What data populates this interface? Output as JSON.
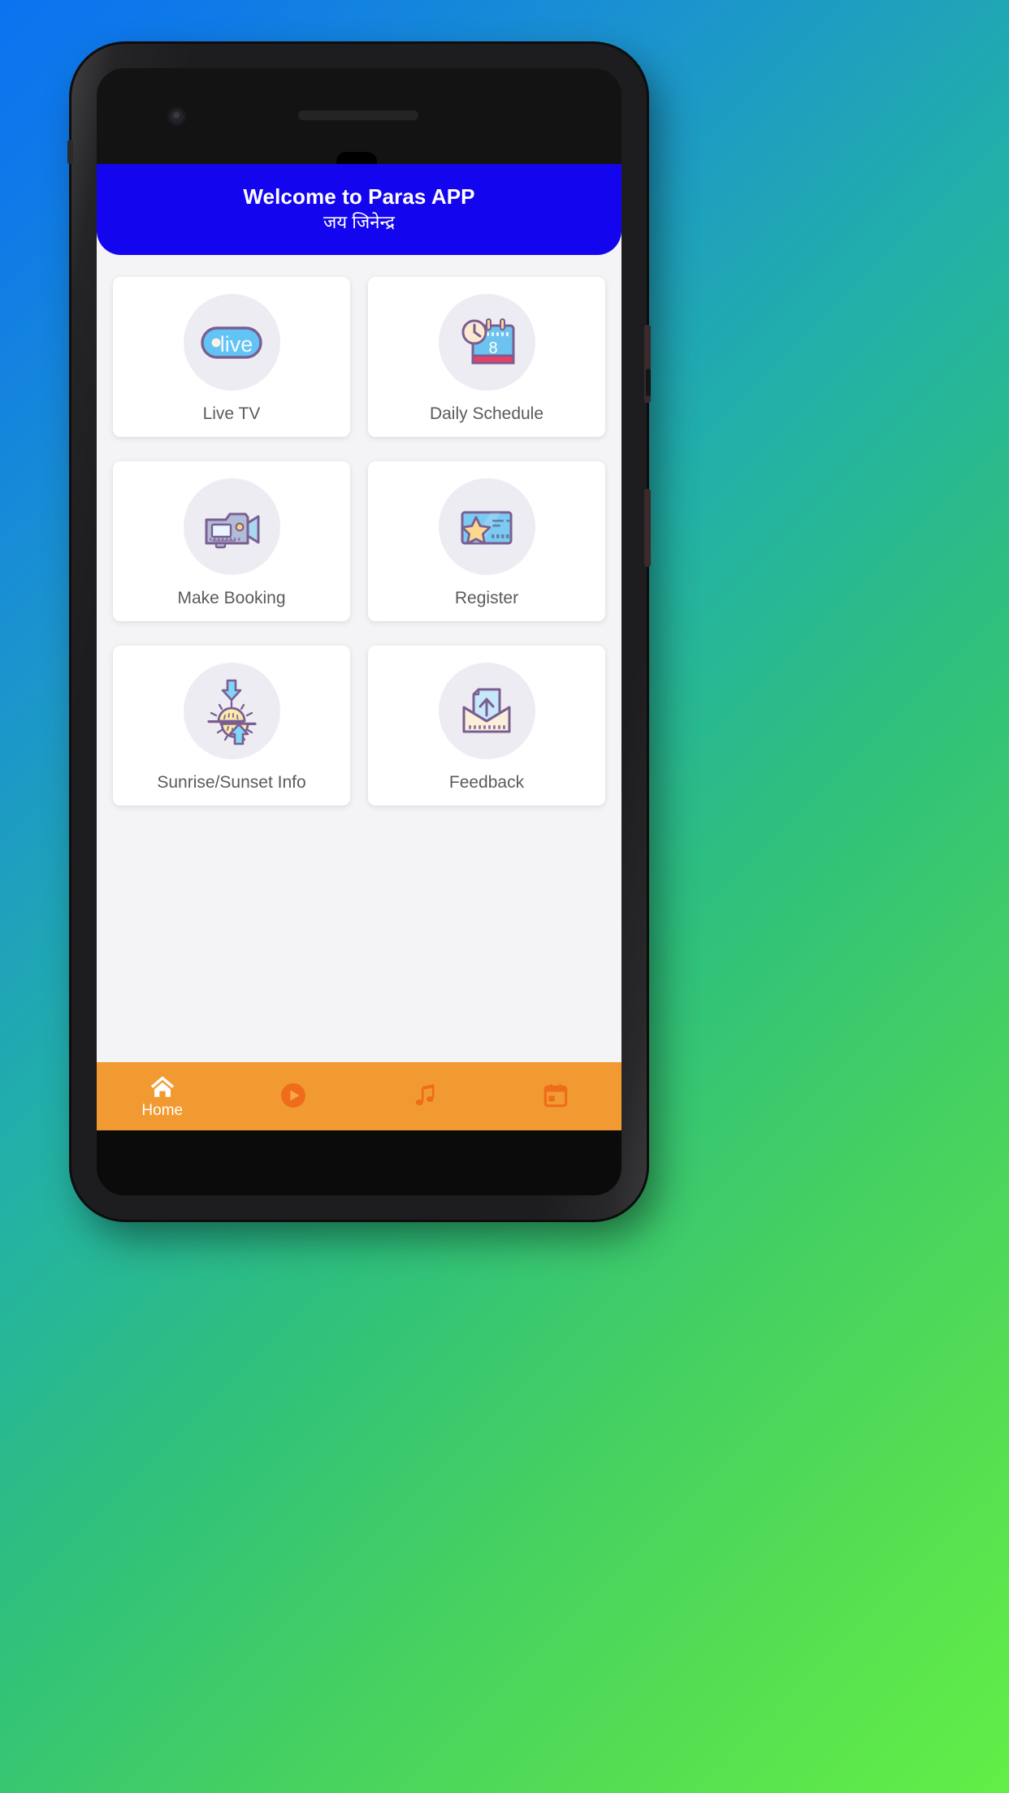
{
  "header": {
    "title": "Welcome to Paras APP",
    "subtitle": "जय जिनेन्द्र",
    "background_color": "#1405ef",
    "text_color": "#ffffff"
  },
  "theme": {
    "screen_background": "#f4f4f6",
    "card_background": "#ffffff",
    "icon_circle_color": "#edecf2",
    "label_color": "#5a5a5f",
    "nav_background": "#f29a32",
    "nav_active_color": "#ffffff",
    "nav_inactive_color": "#ef6c1a",
    "wallpaper_from": "#0a74f0",
    "wallpaper_to": "#62ef46"
  },
  "cards": [
    {
      "id": "live-tv",
      "label": "Live TV",
      "icon": "live-badge-icon"
    },
    {
      "id": "daily-schedule",
      "label": "Daily Schedule",
      "icon": "calendar-clock-icon"
    },
    {
      "id": "make-booking",
      "label": "Make Booking",
      "icon": "video-camera-icon"
    },
    {
      "id": "register",
      "label": "Register",
      "icon": "star-card-icon"
    },
    {
      "id": "sunrise-sunset",
      "label": "Sunrise/Sunset Info",
      "icon": "sunrise-sunset-icon"
    },
    {
      "id": "feedback",
      "label": "Feedback",
      "icon": "envelope-upload-icon"
    }
  ],
  "icon_text": {
    "live_badge": "live",
    "calendar_day": "8"
  },
  "bottom_nav": [
    {
      "id": "home",
      "label": "Home",
      "icon": "home-icon",
      "active": true
    },
    {
      "id": "play",
      "label": "",
      "icon": "play-circle-icon",
      "active": false
    },
    {
      "id": "music",
      "label": "",
      "icon": "music-note-icon",
      "active": false
    },
    {
      "id": "calendar",
      "label": "",
      "icon": "calendar-icon",
      "active": false
    }
  ]
}
